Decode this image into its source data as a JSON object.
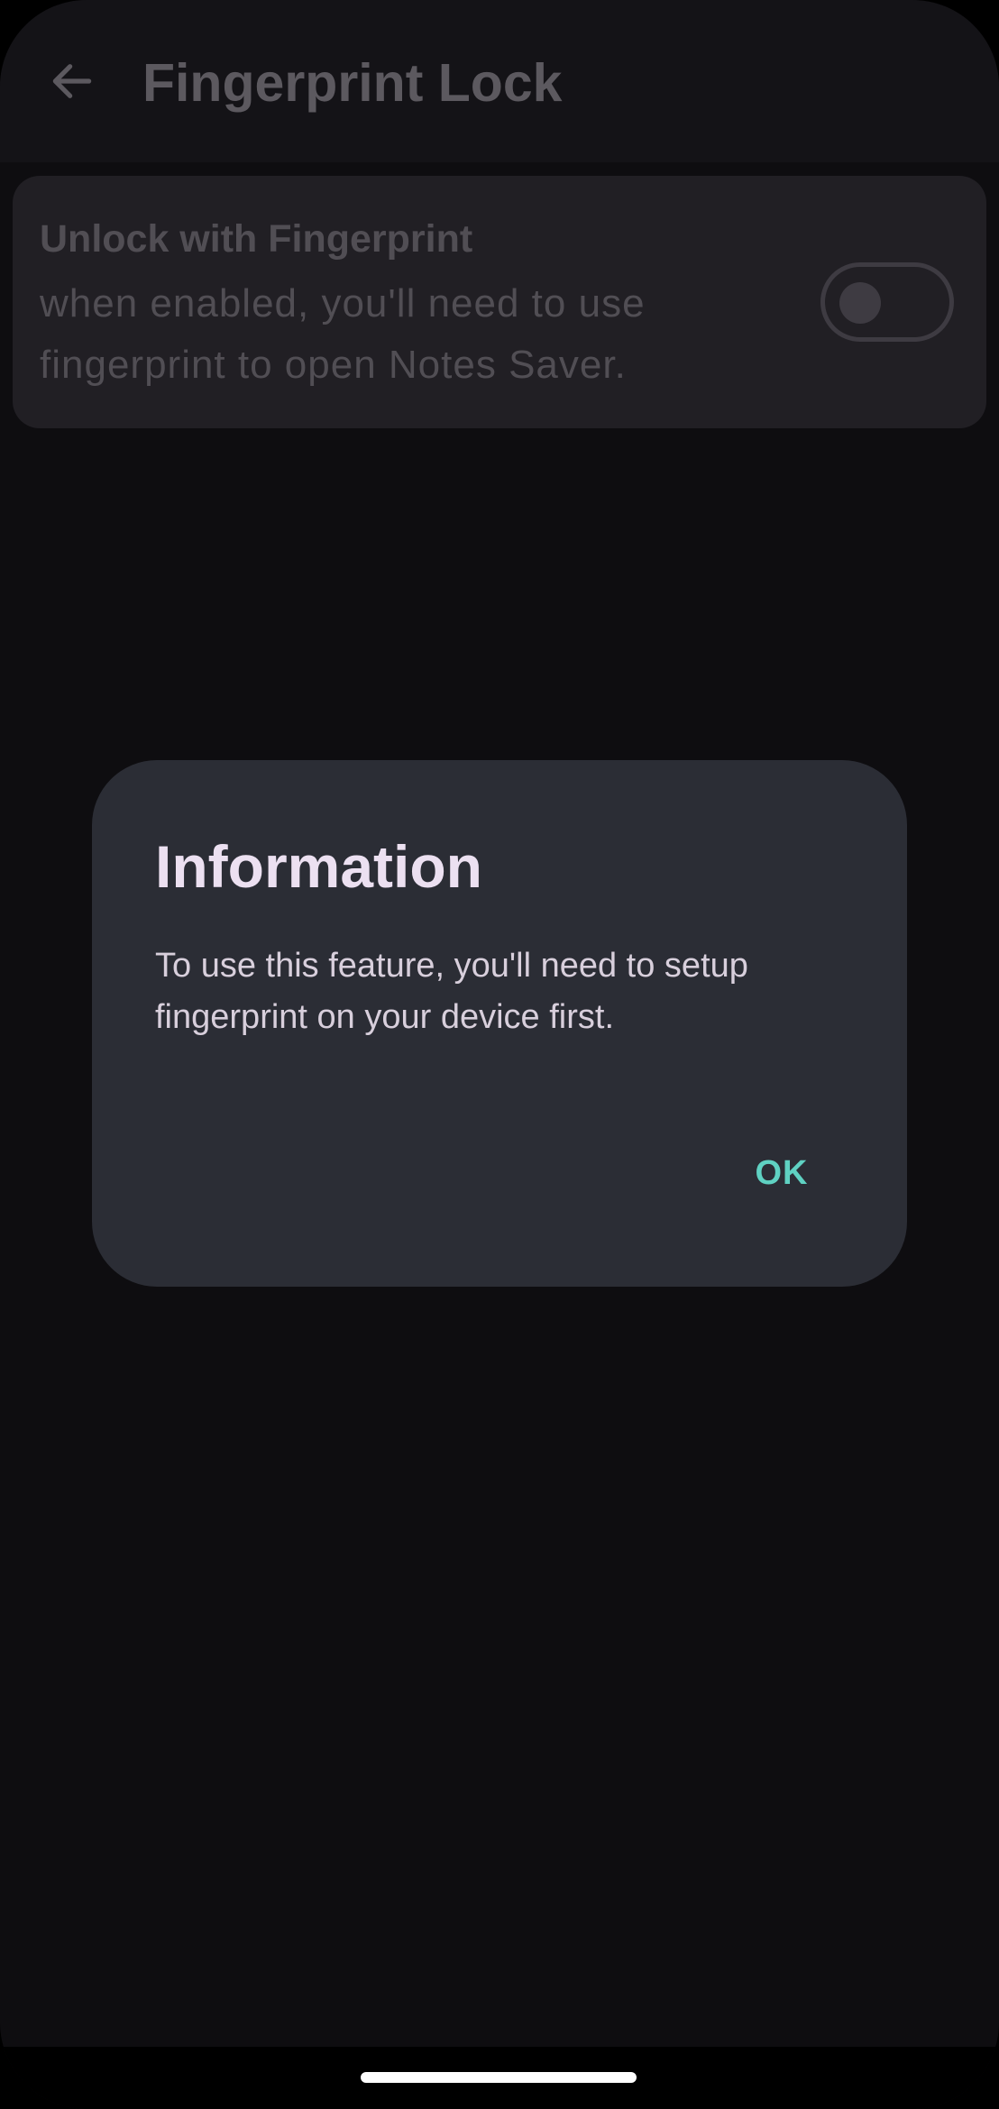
{
  "appbar": {
    "title": "Fingerprint Lock",
    "back_icon": "arrow-left-icon"
  },
  "setting": {
    "title": "Unlock with Fingerprint",
    "description": "when enabled, you'll need to use fingerprint to open Notes Saver.",
    "toggle_state": "off"
  },
  "dialog": {
    "title": "Information",
    "body": "To use this feature, you'll need to setup fingerprint on your device first.",
    "ok_label": "OK"
  },
  "colors": {
    "background": "#0e0d10",
    "dialog_background": "#2b2d35",
    "accent": "#5fd1c2"
  }
}
